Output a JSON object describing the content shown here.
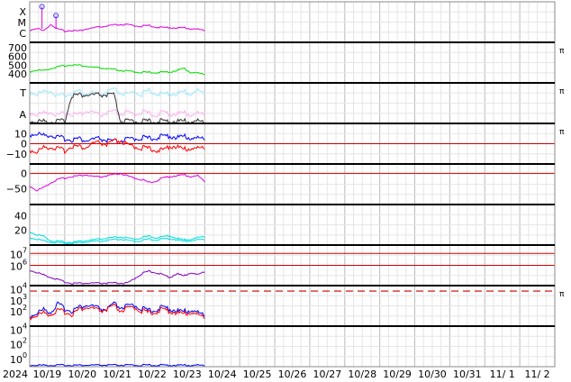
{
  "chart_data": {
    "type": "line",
    "x_range": [
      "2024-10-18T15:00",
      "2024-11-02T15:00"
    ],
    "data_end": "2024-10-23T15:00",
    "x_tick_labels": [
      "2024",
      "10/19",
      "10/20",
      "10/21",
      "10/22",
      "10/23",
      "10/24",
      "10/25",
      "10/26",
      "10/27",
      "10/28",
      "10/29",
      "10/30",
      "10/31",
      "11/ 1",
      "11/ 2"
    ],
    "panels": [
      {
        "id": "xray",
        "y_labels": [
          "X",
          "M",
          "C"
        ],
        "series": [
          {
            "color": "#e000e0",
            "values": [
              0.3,
              0.35,
              0.28,
              0.45,
              0.32,
              0.28,
              0.3,
              0.28,
              0.33,
              0.35,
              0.38,
              0.4,
              0.42,
              0.44,
              0.43,
              0.41,
              0.4,
              0.41,
              0.38,
              0.36,
              0.37,
              0.35,
              0.36,
              0.34,
              0.32,
              0.3
            ]
          },
          {
            "color": "#e000e0",
            "markers": [
              [
                0.35,
                0.88
              ],
              [
                0.75,
                0.66
              ]
            ]
          }
        ],
        "flag": ""
      },
      {
        "id": "solarwind_speed",
        "y_ticks": [
          700,
          600,
          500,
          400
        ],
        "ylim": [
          300,
          760
        ],
        "series": [
          {
            "color": "#00dd00",
            "values": [
              430,
              445,
              440,
              465,
              480,
              495,
              505,
              500,
              490,
              475,
              470,
              460,
              450,
              440,
              432,
              425,
              420,
              418,
              418,
              420,
              425,
              440,
              465,
              420,
              410,
              400
            ]
          }
        ],
        "flag": "π"
      },
      {
        "id": "temperature_alpha",
        "y_labels": [
          "T",
          "A"
        ],
        "series": [
          {
            "color": "#9fe8ff",
            "values": [
              0.8,
              0.72,
              0.78,
              0.82,
              0.65,
              0.7,
              0.74,
              0.8,
              0.72,
              0.76,
              0.68,
              0.78,
              0.82,
              0.75,
              0.7,
              0.78,
              0.72,
              0.8,
              0.75,
              0.7,
              0.76,
              0.72,
              0.78,
              0.74,
              0.8,
              0.76
            ]
          },
          {
            "color": "#ffb0f0",
            "values": [
              0.28,
              0.22,
              0.25,
              0.3,
              0.18,
              0.26,
              0.24,
              0.22,
              0.3,
              0.27,
              0.2,
              0.25,
              0.28,
              0.23,
              0.26,
              0.22,
              0.29,
              0.24,
              0.21,
              0.27,
              0.25,
              0.23,
              0.26,
              0.22,
              0.24,
              0.25
            ]
          },
          {
            "color": "#333333",
            "values": [
              0.05,
              0.05,
              0.05,
              0.05,
              0.05,
              0.05,
              0.7,
              0.7,
              0.7,
              0.7,
              0.7,
              0.7,
              0.7,
              0.05,
              0.05,
              0.05,
              0.05,
              0.05,
              0.05,
              0.05,
              0.05,
              0.05,
              0.05,
              0.05,
              0.05,
              0.05
            ]
          }
        ],
        "flag": "π"
      },
      {
        "id": "imf_b",
        "y_ticks": [
          10,
          0,
          -10
        ],
        "ylim": [
          -20,
          20
        ],
        "zero_line": 0,
        "series": [
          {
            "color": "#0000ff",
            "values": [
              9,
              10,
              8,
              9,
              6,
              5,
              4,
              5,
              3,
              4,
              5,
              3,
              2,
              3,
              4,
              5,
              6,
              5,
              6,
              7,
              8,
              6,
              7,
              6,
              5,
              6
            ]
          },
          {
            "color": "#ff0000",
            "values": [
              -6,
              -8,
              -4,
              -3,
              -5,
              -7,
              -2,
              -3,
              -4,
              0,
              1,
              -1,
              2,
              3,
              -2,
              -3,
              -4,
              -5,
              -6,
              -7,
              -2,
              -3,
              -6,
              -4,
              -5,
              -3
            ]
          }
        ],
        "flag": "π"
      },
      {
        "id": "dst",
        "y_ticks": [
          0,
          -50
        ],
        "ylim": [
          -100,
          30
        ],
        "zero_line": 0,
        "series": [
          {
            "color": "#e000e0",
            "values": [
              -40,
              -55,
              -45,
              -30,
              -20,
              -15,
              -10,
              -8,
              -5,
              -10,
              -12,
              -8,
              -5,
              0,
              -10,
              -15,
              -20,
              -30,
              -25,
              -15,
              -10,
              -8,
              -5,
              -10,
              -8,
              -25
            ]
          }
        ],
        "flag": ""
      },
      {
        "id": "kp_like",
        "y_ticks": [
          40,
          20
        ],
        "ylim": [
          0,
          55
        ],
        "series": [
          {
            "color": "#00dddd",
            "values": [
              18,
              14,
              12,
              6,
              5,
              4,
              4,
              5,
              6,
              7,
              8,
              9,
              10,
              11,
              9,
              8,
              10,
              12,
              10,
              11,
              13,
              9,
              7,
              8,
              10,
              12
            ]
          },
          {
            "color": "#00dddd",
            "values": [
              10,
              8,
              6,
              4,
              3,
              2,
              3,
              3,
              4,
              5,
              5,
              6,
              7,
              8,
              6,
              5,
              6,
              8,
              7,
              8,
              9,
              7,
              5,
              6,
              7,
              8
            ]
          }
        ],
        "flag": ""
      },
      {
        "id": "electron_flux",
        "y_ticks_exp": [
          7,
          6
        ],
        "ylim_exp": [
          4.3,
          7.7
        ],
        "ref_lines_exp": [
          7,
          6
        ],
        "series": [
          {
            "color": "#8000c0",
            "values": [
              5.6,
              5.4,
              5.2,
              5.0,
              4.8,
              4.6,
              4.5,
              4.5,
              4.5,
              4.5,
              4.5,
              4.5,
              4.5,
              4.5,
              4.5,
              4.9,
              5.3,
              5.5,
              5.4,
              5.2,
              5.0,
              5.3,
              5.1,
              5.4,
              5.2,
              5.5
            ]
          }
        ],
        "flag": ""
      },
      {
        "id": "proton_flux",
        "y_ticks_exp": [
          4,
          3,
          2
        ],
        "ylim_exp": [
          0.6,
          4.3
        ],
        "dashed_line_exp": 4,
        "series": [
          {
            "color": "#0000ff",
            "values": [
              1.5,
              1.8,
              2.1,
              1.9,
              2.6,
              2.2,
              2.0,
              2.3,
              2.5,
              2.4,
              2.2,
              2.1,
              2.6,
              2.3,
              2.4,
              2.5,
              2.2,
              2.0,
              2.1,
              2.3,
              2.2,
              2.0,
              1.9,
              2.1,
              1.8,
              1.7
            ]
          },
          {
            "color": "#ff0000",
            "values": [
              1.4,
              1.6,
              1.8,
              1.7,
              2.0,
              1.9,
              1.7,
              2.1,
              2.3,
              2.2,
              2.0,
              2.1,
              2.4,
              2.0,
              2.2,
              2.3,
              2.0,
              1.8,
              1.9,
              2.1,
              2.0,
              1.8,
              1.7,
              1.9,
              1.6,
              1.5
            ]
          }
        ],
        "flag": "π"
      },
      {
        "id": "neutron",
        "y_ticks_exp": [
          4,
          2,
          0
        ],
        "ylim_exp": [
          -1.1,
          4.4
        ],
        "series": [
          {
            "color": "#0000ff",
            "values": [
              -0.9,
              -0.9,
              -0.9,
              -0.9,
              -0.9,
              -0.9,
              -0.9,
              -0.9,
              -0.9,
              -0.9,
              -0.9,
              -0.9,
              -0.9,
              -0.9,
              -0.9,
              -0.9,
              -0.9,
              -0.9,
              -0.9,
              -0.9,
              -0.9,
              -0.9,
              -0.9,
              -0.9,
              -0.9,
              -0.9
            ]
          }
        ],
        "flag": ""
      }
    ]
  }
}
